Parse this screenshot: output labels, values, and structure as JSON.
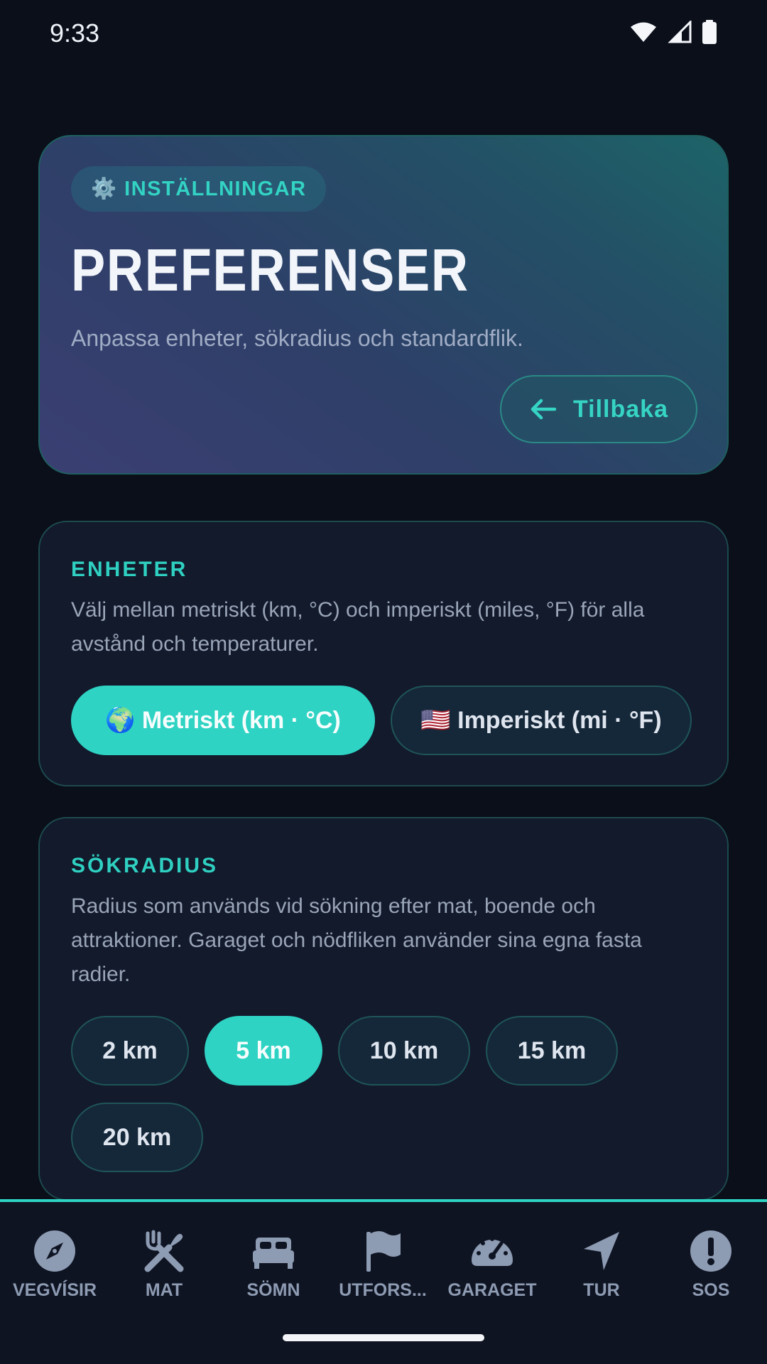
{
  "status_bar": {
    "time": "9:33"
  },
  "hero": {
    "badge_icon": "gear-icon",
    "badge_label": "⚙️ INSTÄLLNINGAR",
    "title": "PREFERENSER",
    "subtitle": "Anpassa enheter, sökradius och standardflik.",
    "back_label": "Tillbaka"
  },
  "units": {
    "title": "ENHETER",
    "description": "Välj mellan metriskt (km, °C) och imperiskt (miles, °F) för alla avstånd och temperaturer.",
    "options": [
      {
        "label": "🌍 Metriskt  (km · °C)",
        "selected": true
      },
      {
        "label": "🇺🇸 Imperiskt (mi · °F)",
        "selected": false
      }
    ]
  },
  "radius": {
    "title": "SÖKRADIUS",
    "description": "Radius som används vid sökning efter mat, boende och attraktioner. Garaget och nödfliken använder sina egna fasta radier.",
    "options": [
      {
        "label": "2 km",
        "selected": false
      },
      {
        "label": "5 km",
        "selected": true
      },
      {
        "label": "10 km",
        "selected": false
      },
      {
        "label": "15 km",
        "selected": false
      },
      {
        "label": "20 km",
        "selected": false
      }
    ]
  },
  "bottom_nav": [
    {
      "label": "VEGVÍSIR",
      "icon": "compass-icon"
    },
    {
      "label": "MAT",
      "icon": "utensils-icon"
    },
    {
      "label": "SÖMN",
      "icon": "bed-icon"
    },
    {
      "label": "UTFORS...",
      "icon": "flag-icon"
    },
    {
      "label": "GARAGET",
      "icon": "speedometer-icon"
    },
    {
      "label": "TUR",
      "icon": "navigation-arrow-icon"
    },
    {
      "label": "SOS",
      "icon": "alert-icon"
    }
  ],
  "colors": {
    "accent": "#2ed3c3",
    "background": "#0a0f1a",
    "card": "#121a2c",
    "nav_icon": "#8d9bb3"
  }
}
